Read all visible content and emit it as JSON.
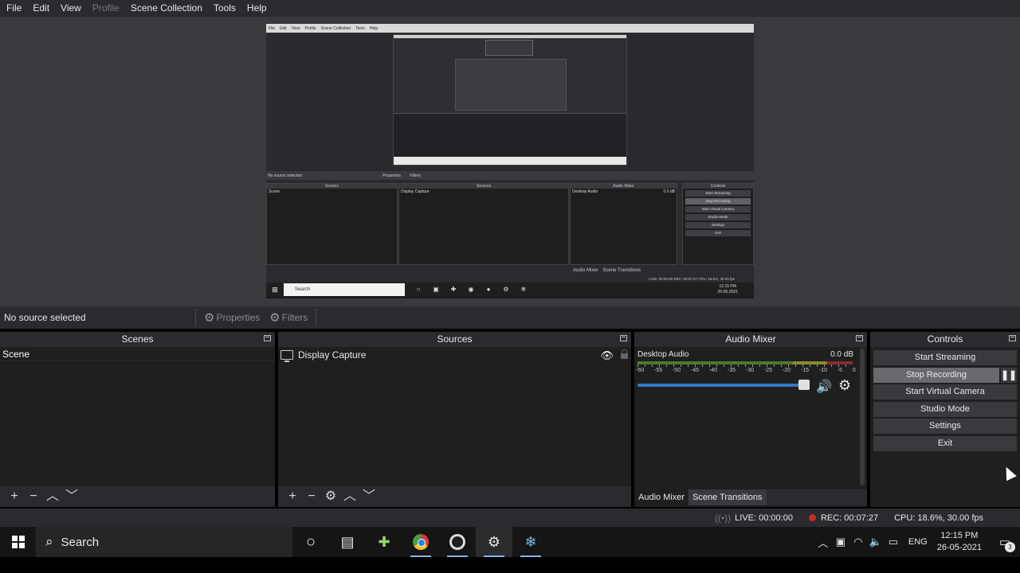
{
  "menu": {
    "items": [
      {
        "label": "File",
        "disabled": false
      },
      {
        "label": "Edit",
        "disabled": false
      },
      {
        "label": "View",
        "disabled": false
      },
      {
        "label": "Profile",
        "disabled": true
      },
      {
        "label": "Scene Collection",
        "disabled": false
      },
      {
        "label": "Tools",
        "disabled": false
      },
      {
        "label": "Help",
        "disabled": false
      }
    ]
  },
  "preview": {
    "menu": [
      "File",
      "Edit",
      "View",
      "Profile",
      "Scene Collection",
      "Tools",
      "Help"
    ],
    "source_label": "No source selected",
    "properties": "Properties",
    "filters": "Filters",
    "scenes_title": "Scenes",
    "scene": "Scene",
    "sources_title": "Sources",
    "source": "Display Capture",
    "mixer_title": "Audio Mixer",
    "track": "Desktop Audio",
    "track_db": "0.0 dB",
    "controls_title": "Controls",
    "controls": [
      "Start Streaming",
      "Stop Recording",
      "Start Virtual Camera",
      "Studio Mode",
      "Settings",
      "Exit"
    ],
    "mixer_tabs": [
      "Audio Mixer",
      "Scene Transitions"
    ],
    "status": "LIVE: 00:00:00   REC: 00:07:27   CPU: 18.6%, 30.00 fps",
    "search": "Search",
    "time": "12:15 PM",
    "date": "26-05-2021"
  },
  "source_bar": {
    "no_source": "No source selected",
    "properties": "Properties",
    "filters": "Filters"
  },
  "scenes": {
    "title": "Scenes",
    "items": [
      "Scene"
    ]
  },
  "sources": {
    "title": "Sources",
    "items": [
      {
        "name": "Display Capture",
        "visible": true,
        "locked": false
      }
    ]
  },
  "mixer": {
    "title": "Audio Mixer",
    "track_name": "Desktop Audio",
    "track_db": "0.0 dB",
    "scale": [
      "-60",
      "-55",
      "-50",
      "-45",
      "-40",
      "-35",
      "-30",
      "-25",
      "-20",
      "-15",
      "-10",
      "-5",
      "0"
    ],
    "volume_fraction": 0.97,
    "tabs": [
      "Audio Mixer",
      "Scene Transitions"
    ],
    "active_tab": "Audio Mixer"
  },
  "controls": {
    "title": "Controls",
    "start_streaming": "Start Streaming",
    "stop_recording": "Stop Recording",
    "pause": "❚❚",
    "start_virtual_camera": "Start Virtual Camera",
    "studio_mode": "Studio Mode",
    "settings": "Settings",
    "exit": "Exit"
  },
  "status": {
    "live": "LIVE: 00:00:00",
    "rec": "REC: 00:07:27",
    "cpu": "CPU: 18.6%, 30.00 fps",
    "rec_color": "#c92a2a"
  },
  "taskbar": {
    "search": "Search",
    "language": "ENG",
    "time": "12:15 PM",
    "date": "26-05-2021",
    "notifications": "3"
  }
}
